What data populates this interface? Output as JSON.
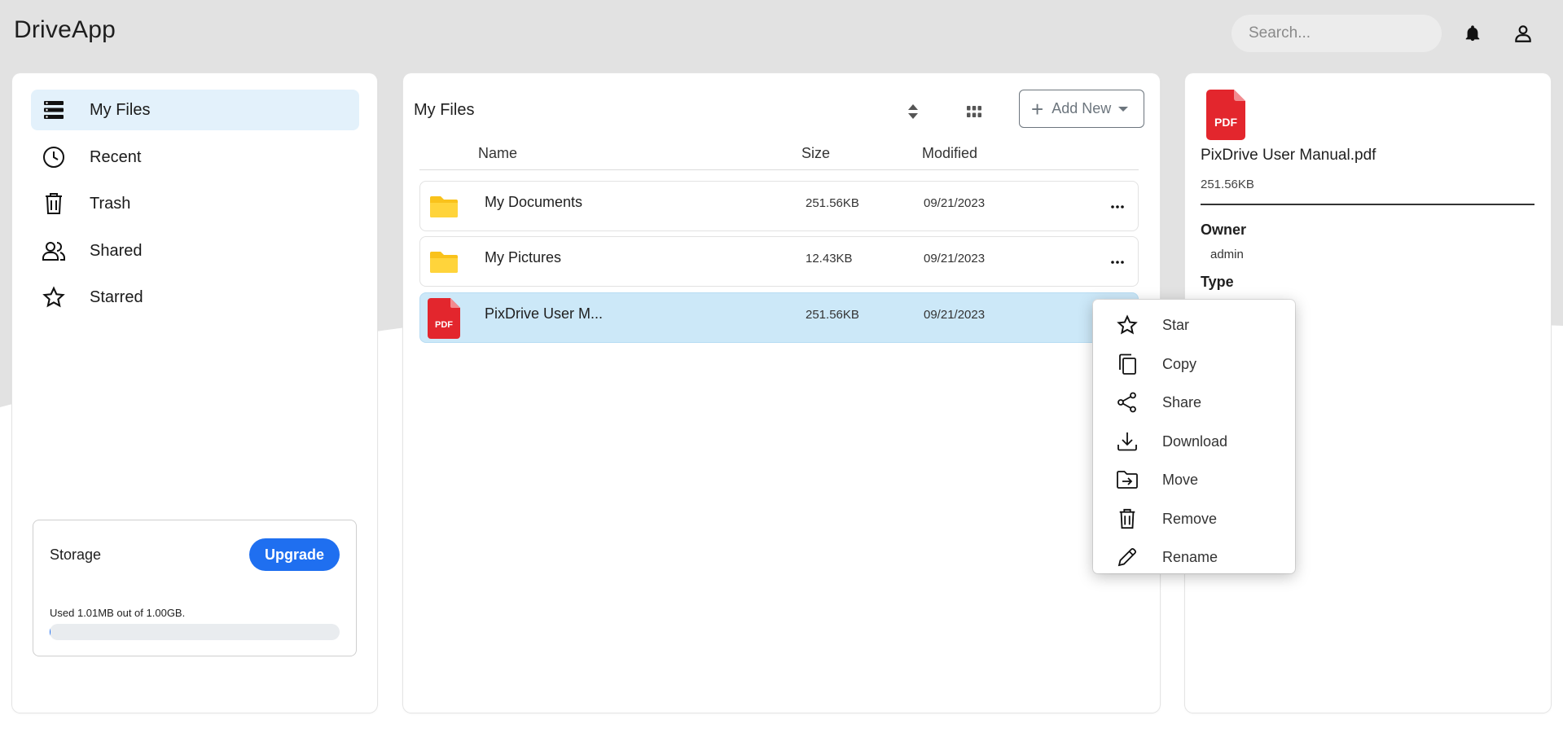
{
  "app": {
    "title": "DriveApp"
  },
  "header": {
    "search_placeholder": "Search..."
  },
  "sidebar": {
    "items": [
      {
        "label": "My Files",
        "icon": "stack-icon",
        "active": true
      },
      {
        "label": "Recent",
        "icon": "clock-icon",
        "active": false
      },
      {
        "label": "Trash",
        "icon": "trash-icon",
        "active": false
      },
      {
        "label": "Shared",
        "icon": "users-icon",
        "active": false
      },
      {
        "label": "Starred",
        "icon": "star-icon",
        "active": false
      }
    ],
    "storage": {
      "title": "Storage",
      "upgrade_label": "Upgrade",
      "used_text": "Used 1.01MB out of 1.00GB.",
      "used_fraction": 0.001
    }
  },
  "main": {
    "title": "My Files",
    "add_new_label": "Add New",
    "columns": {
      "name": "Name",
      "size": "Size",
      "modified": "Modified"
    },
    "files": [
      {
        "name": "My Documents",
        "size": "251.56KB",
        "modified": "09/21/2023",
        "type": "folder",
        "selected": false
      },
      {
        "name": "My Pictures",
        "size": "12.43KB",
        "modified": "09/21/2023",
        "type": "folder",
        "selected": false
      },
      {
        "name": "PixDrive User M...",
        "size": "251.56KB",
        "modified": "09/21/2023",
        "type": "pdf",
        "selected": true
      }
    ]
  },
  "details": {
    "file_badge": "PDF",
    "file_name": "PixDrive User Manual.pdf",
    "file_size": "251.56KB",
    "owner_label": "Owner",
    "owner_value": "admin",
    "type_label": "Type"
  },
  "context_menu": {
    "items": [
      {
        "label": "Star",
        "icon": "star-icon"
      },
      {
        "label": "Copy",
        "icon": "copy-icon"
      },
      {
        "label": "Share",
        "icon": "share-icon"
      },
      {
        "label": "Download",
        "icon": "download-icon"
      },
      {
        "label": "Move",
        "icon": "move-icon"
      },
      {
        "label": "Remove",
        "icon": "trash-icon"
      },
      {
        "label": "Rename",
        "icon": "pencil-icon"
      }
    ]
  },
  "colors": {
    "accent": "#1f6ff0",
    "selected_row": "#cce8f8",
    "active_nav": "#e3f1fb",
    "folder": "#f9c21b",
    "pdf": "#e3262d"
  }
}
